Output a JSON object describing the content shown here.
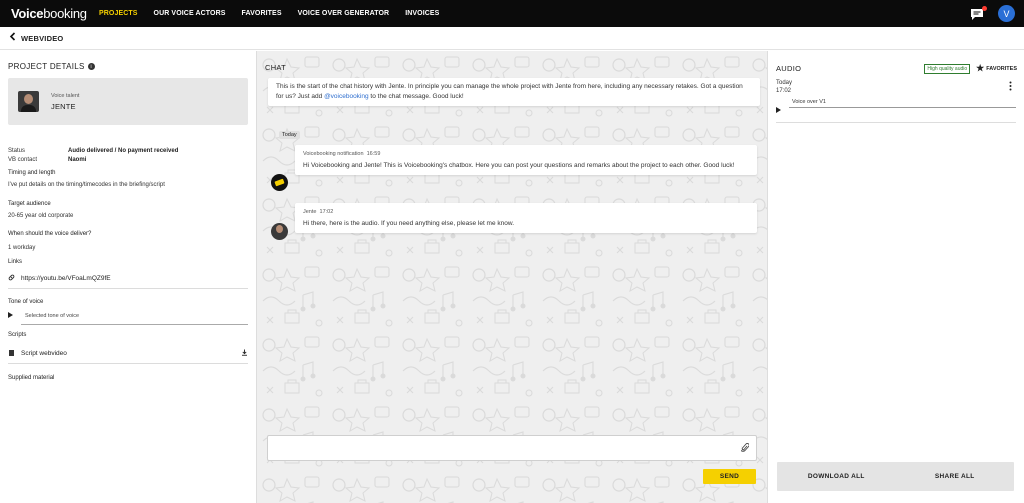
{
  "nav": {
    "logo_a": "Voice",
    "logo_b": "booking",
    "items": [
      {
        "label": "PROJECTS",
        "active": true
      },
      {
        "label": "OUR VOICE ACTORS",
        "active": false
      },
      {
        "label": "FAVORITES",
        "active": false
      },
      {
        "label": "VOICE OVER GENERATOR",
        "active": false
      },
      {
        "label": "INVOICES",
        "active": false
      }
    ],
    "user_initial": "V",
    "accent": "#f5d000"
  },
  "subheader": {
    "back_icon": "chevron-left-icon",
    "title": "WEBVIDEO"
  },
  "project": {
    "section_title": "PROJECT DETAILS",
    "talent_label": "Voice talent",
    "talent_name": "JENTE",
    "status_label": "Status",
    "status_value": "Audio delivered / No payment received",
    "vb_contact_label": "VB contact",
    "vb_contact_value": "Naomi",
    "timing_label": "Timing and length",
    "timing_value": "I've put details on the timing/timecodes in the briefing/script",
    "audience_label": "Target audience",
    "audience_value": "20-65 year old corporate",
    "deliver_label": "When should the voice deliver?",
    "deliver_value": "1 workday",
    "links_label": "Links",
    "link_url": "https://youtu.be/VFoaLmQZ9fE",
    "tone_label": "Tone of voice",
    "tone_track": "Selected tone of voice",
    "scripts_label": "Scripts",
    "script_name": "Script webvideo",
    "supplied_label": "Supplied material"
  },
  "chat": {
    "title": "CHAT",
    "intro_a": "This is the start of the chat history with Jente. In principle you can manage the whole project with Jente from here, including any necessary retakes. Got a question for us? Just add ",
    "intro_mention": "@voicebooking",
    "intro_b": " to the chat message. Good luck!",
    "day_label": "Today",
    "messages": [
      {
        "sender": "Voicebooking notification",
        "time": "16:59",
        "text": "Hi Voicebooking and Jente! This is Voicebooking's chatbox. Here you can post your questions and remarks about the project to each other. Good luck!"
      },
      {
        "sender": "Jente",
        "time": "17:02",
        "text": "Hi there, here is the audio. If you need anything else, please let me know."
      }
    ],
    "input_placeholder": "",
    "send_label": "SEND"
  },
  "audio": {
    "title": "AUDIO",
    "hq_label": "High quality audio",
    "favorites_label": "FAVORITES",
    "item": {
      "date": "Today",
      "time": "17:02",
      "track": "Voice over V1"
    },
    "download_label": "DOWNLOAD ALL",
    "share_label": "SHARE ALL"
  }
}
